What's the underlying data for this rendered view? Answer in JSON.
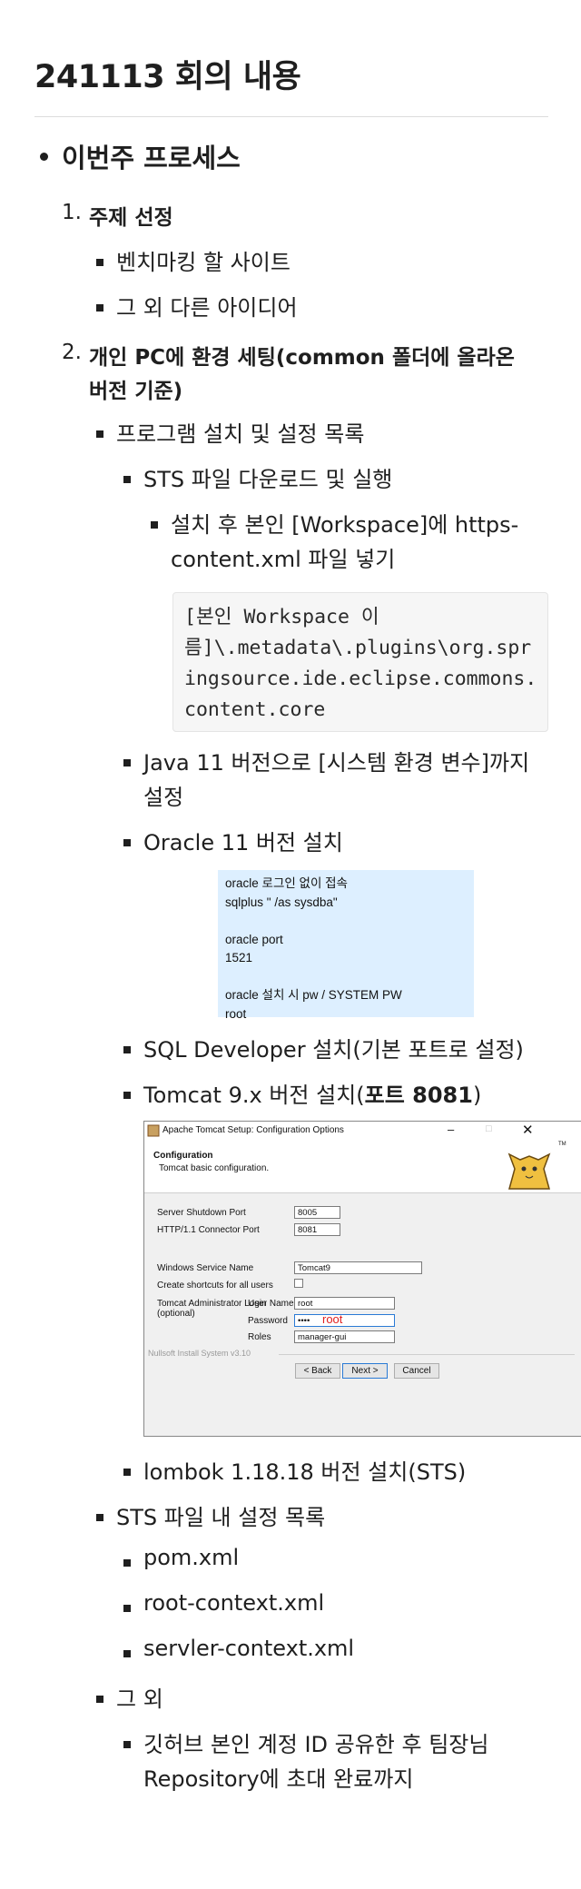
{
  "heading": "241113 회의 내용",
  "section": "이번주 프로세스",
  "items": [
    {
      "num": "1.",
      "title": "주제 선정"
    },
    {
      "num": "2.",
      "title_line1": "개인 PC에 환경 세팅(common 폴더에 올라온",
      "title_line2": "버전 기준)"
    }
  ],
  "topic_subitems": [
    "벤치마킹 할 사이트",
    "그 외 다른 아이디어"
  ],
  "install_list": "프로그램 설치 및 설정 목록",
  "sts": {
    "label": "STS 파일 다운로드 및 실행",
    "sub_line1": "설치 후 본인 [Workspace]에 https-",
    "sub_line2": "content.xml 파일 넣기",
    "code_lines": [
      "[본인 Workspace 이",
      "름]\\.metadata\\.plugins\\org.spr",
      "ingsource.ide.eclipse.commons.",
      "content.core"
    ]
  },
  "java_line1": "Java 11 버전으로 [시스템 환경 변수]까지",
  "java_line2": "설정",
  "oracle": {
    "label": "Oracle 11 버전 설치",
    "note_lines": [
      "oracle 로그인 없이 접속",
      "sqlplus \" /as sysdba\"",
      "",
      "oracle port",
      "1521",
      "",
      "oracle 설치 시 pw / SYSTEM PW",
      "root"
    ]
  },
  "sqldev": "SQL Developer 설치(기본 포트로 설정)",
  "tomcat": {
    "label_prefix": "Tomcat 9.x 버전 설치(",
    "label_bold": "포트 8081",
    "label_suffix": ")",
    "dialog": {
      "title": "Apache Tomcat Setup: Configuration Options",
      "header": "Configuration",
      "subheader": "Tomcat basic configuration.",
      "shutdown_label": "Server Shutdown Port",
      "shutdown_value": "8005",
      "http_label": "HTTP/1.1 Connector Port",
      "http_value": "8081",
      "service_label": "Windows Service Name",
      "service_value": "Tomcat9",
      "shortcuts_label": "Create shortcuts for all users",
      "admin_label": "Tomcat Administrator Login",
      "admin_sub": "(optional)",
      "user_label": "User Name",
      "user_value": "root",
      "pass_label": "Password",
      "pass_value": "••••",
      "pass_annotation": "root",
      "roles_label": "Roles",
      "roles_value": "manager-gui",
      "footer": "Nullsoft Install System v3.10",
      "back": "< Back",
      "next": "Next >",
      "cancel": "Cancel",
      "tm": "TM",
      "annotation_color": "#e02020"
    }
  },
  "lombok": "lombok 1.18.18 버전 설치(STS)",
  "sts_settings": "STS 파일 내 설정 목록",
  "settings_files": [
    "pom.xml",
    "root-context.xml",
    "servler-context.xml"
  ],
  "etc": "그 외",
  "github_line1": "깃허브 본인 계정 ID 공유한 후 팀장님",
  "github_line2": "Repository에 초대 완료까지"
}
